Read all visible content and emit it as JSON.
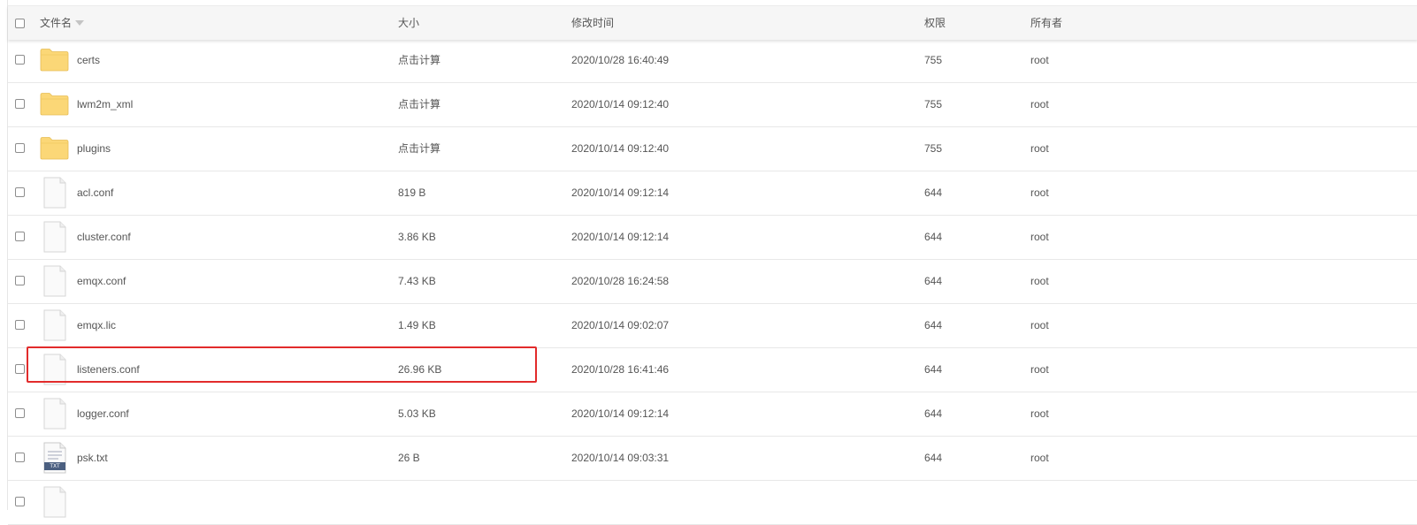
{
  "header": {
    "name_label": "文件名",
    "size_label": "大小",
    "modified_label": "修改时间",
    "permission_label": "权限",
    "owner_label": "所有者"
  },
  "calc_label": "点击计算",
  "rows": [
    {
      "name": "certs",
      "type": "folder",
      "size": "点击计算",
      "modified": "2020/10/28 16:40:49",
      "permission": "755",
      "owner": "root"
    },
    {
      "name": "lwm2m_xml",
      "type": "folder",
      "size": "点击计算",
      "modified": "2020/10/14 09:12:40",
      "permission": "755",
      "owner": "root"
    },
    {
      "name": "plugins",
      "type": "folder",
      "size": "点击计算",
      "modified": "2020/10/14 09:12:40",
      "permission": "755",
      "owner": "root"
    },
    {
      "name": "acl.conf",
      "type": "file",
      "size": "819 B",
      "modified": "2020/10/14 09:12:14",
      "permission": "644",
      "owner": "root"
    },
    {
      "name": "cluster.conf",
      "type": "file",
      "size": "3.86 KB",
      "modified": "2020/10/14 09:12:14",
      "permission": "644",
      "owner": "root"
    },
    {
      "name": "emqx.conf",
      "type": "file",
      "size": "7.43 KB",
      "modified": "2020/10/28 16:24:58",
      "permission": "644",
      "owner": "root"
    },
    {
      "name": "emqx.lic",
      "type": "file",
      "size": "1.49 KB",
      "modified": "2020/10/14 09:02:07",
      "permission": "644",
      "owner": "root"
    },
    {
      "name": "listeners.conf",
      "type": "file",
      "size": "26.96 KB",
      "modified": "2020/10/28 16:41:46",
      "permission": "644",
      "owner": "root"
    },
    {
      "name": "logger.conf",
      "type": "file",
      "size": "5.03 KB",
      "modified": "2020/10/14 09:12:14",
      "permission": "644",
      "owner": "root"
    },
    {
      "name": "psk.txt",
      "type": "txt",
      "size": "26 B",
      "modified": "2020/10/14 09:03:31",
      "permission": "644",
      "owner": "root"
    },
    {
      "name": "",
      "type": "file",
      "size": "",
      "modified": "",
      "permission": "",
      "owner": ""
    }
  ],
  "highlighted_file": "listeners.conf",
  "txt_icon_label": "TXT",
  "colors": {
    "accent_green": "#20a53a",
    "highlight_red": "#e22b2b",
    "folder_yellow": "#fbd777"
  },
  "icons": {
    "folder": "folder-icon",
    "file": "file-icon",
    "txt": "txt-file-icon",
    "sort": "sort-caret-icon"
  }
}
